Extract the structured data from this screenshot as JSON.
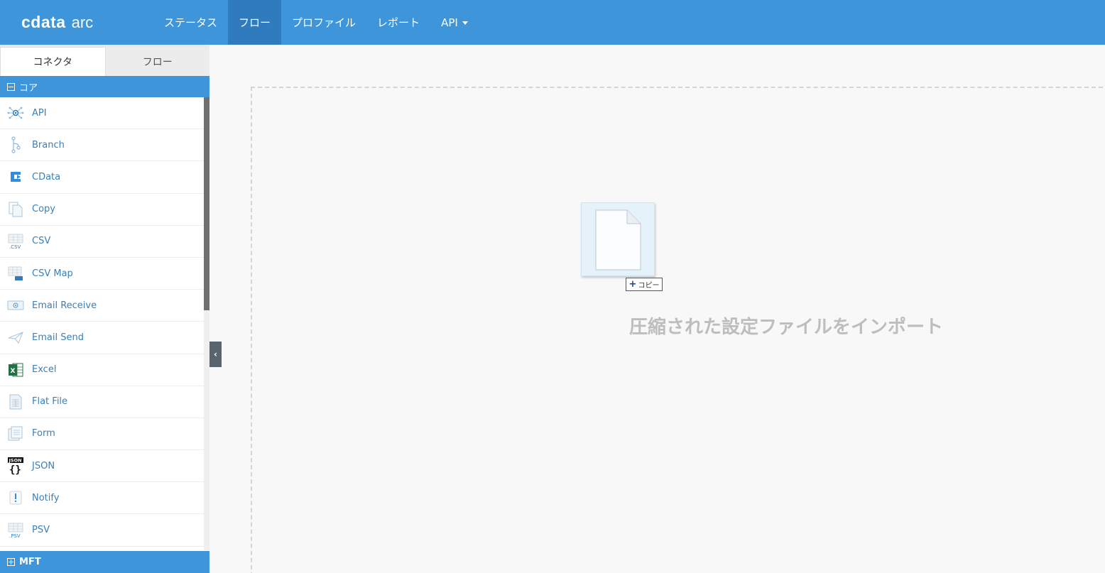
{
  "brand": {
    "name": "cdata",
    "suffix": "arc"
  },
  "nav": {
    "items": [
      {
        "label": "ステータス"
      },
      {
        "label": "フロー"
      },
      {
        "label": "プロファイル"
      },
      {
        "label": "レポート"
      },
      {
        "label": "API"
      }
    ],
    "active_index": 1
  },
  "sidebar": {
    "tabs": [
      {
        "label": "コネクタ"
      },
      {
        "label": "フロー"
      }
    ],
    "sections": {
      "core": {
        "label": "コア"
      },
      "mft": {
        "label": "MFT"
      }
    },
    "items": [
      {
        "label": "API",
        "icon": "api-icon"
      },
      {
        "label": "Branch",
        "icon": "branch-icon"
      },
      {
        "label": "CData",
        "icon": "cdata-icon"
      },
      {
        "label": "Copy",
        "icon": "copy-icon"
      },
      {
        "label": "CSV",
        "icon": "csv-icon"
      },
      {
        "label": "CSV Map",
        "icon": "csv-map-icon"
      },
      {
        "label": "Email Receive",
        "icon": "email-receive-icon"
      },
      {
        "label": "Email Send",
        "icon": "email-send-icon"
      },
      {
        "label": "Excel",
        "icon": "excel-icon"
      },
      {
        "label": "Flat File",
        "icon": "flat-file-icon"
      },
      {
        "label": "Form",
        "icon": "form-icon"
      },
      {
        "label": "JSON",
        "icon": "json-icon"
      },
      {
        "label": "Notify",
        "icon": "notify-icon"
      },
      {
        "label": "PSV",
        "icon": "psv-icon"
      }
    ]
  },
  "main": {
    "drag_badge": "コピー",
    "import_text": "圧縮された設定ファイルをインポート"
  },
  "colors": {
    "accent": "#3e95d9",
    "nav_active": "#2f7bbd",
    "link": "#3a7fb8"
  }
}
